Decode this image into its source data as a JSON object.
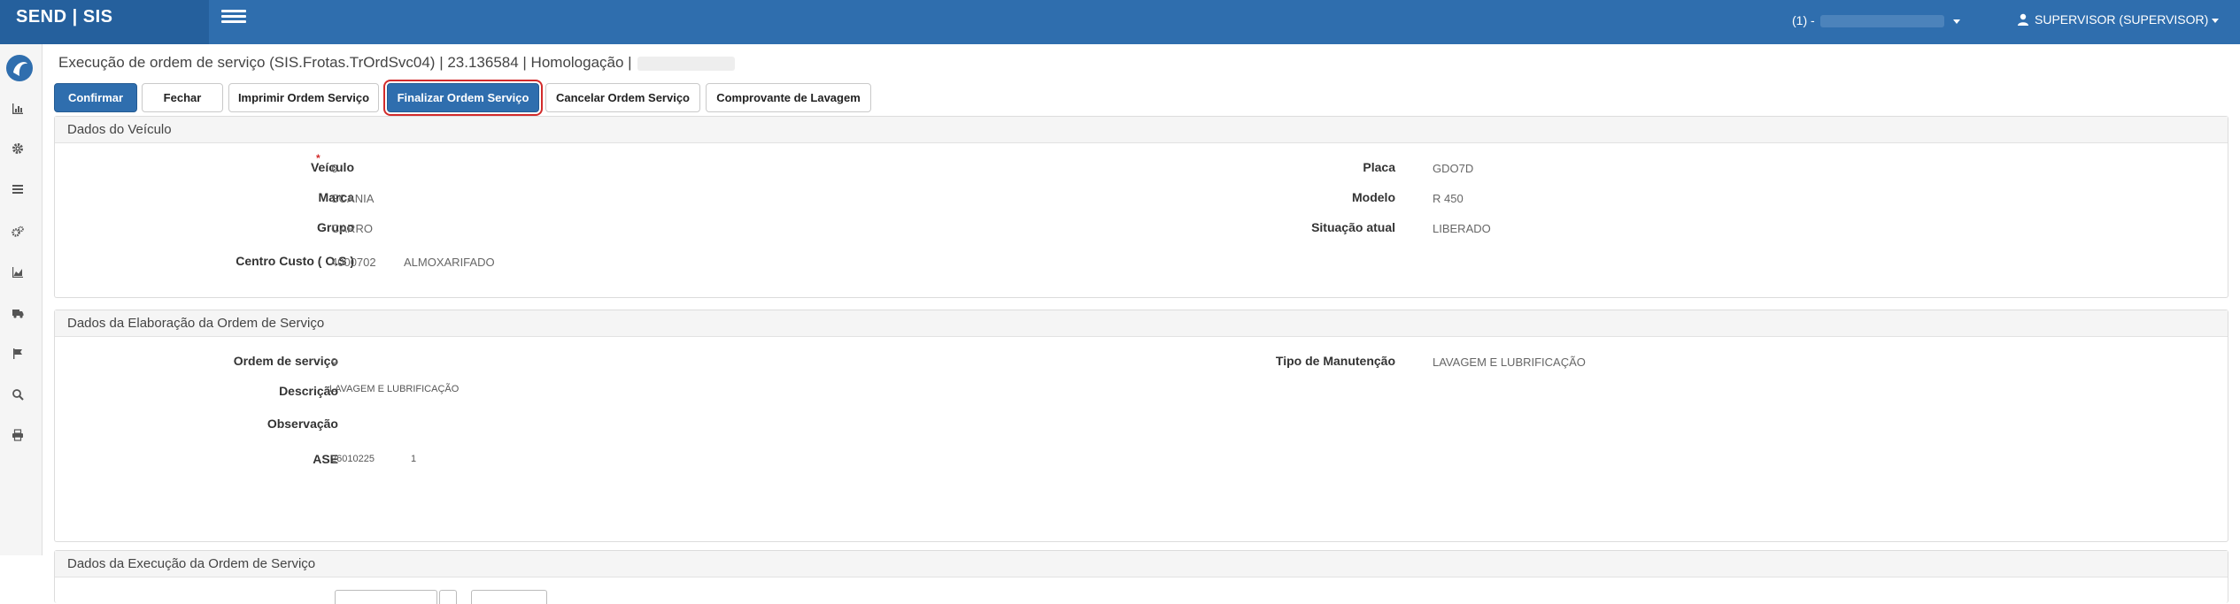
{
  "topbar": {
    "brand": "SEND | SIS",
    "store_prefix": "(1) -",
    "user": "SUPERVISOR (SUPERVISOR)"
  },
  "sidebar": {
    "items": [
      {
        "icon": "bar-chart-icon"
      },
      {
        "icon": "gear-icon"
      },
      {
        "icon": "list-icon"
      },
      {
        "icon": "gears-icon"
      },
      {
        "icon": "area-chart-icon"
      },
      {
        "icon": "truck-icon"
      },
      {
        "icon": "flag-icon"
      },
      {
        "icon": "search-icon"
      },
      {
        "icon": "print-icon"
      }
    ]
  },
  "page": {
    "title": "Execução de ordem de serviço (SIS.Frotas.TrOrdSvc04) | 23.136584 | Homologação |"
  },
  "toolbar": {
    "confirm": "Confirmar",
    "close": "Fechar",
    "print_os": "Imprimir Ordem Serviço",
    "finish_os": "Finalizar Ordem Serviço",
    "cancel_os": "Cancelar Ordem Serviço",
    "wash_receipt": "Comprovante de Lavagem"
  },
  "vehicle": {
    "heading": "Dados do Veículo",
    "veiculo_label": "Veículo",
    "veiculo_value": "6",
    "marca_label": "Marca",
    "marca_value": "SCANIA",
    "grupo_label": "Grupo",
    "grupo_value": "CARRO",
    "cc_label": "Centro Custo ( O.S )",
    "cc_code": "4000702",
    "cc_name": "ALMOXARIFADO",
    "placa_label": "Placa",
    "placa_value": "GDO7D",
    "modelo_label": "Modelo",
    "modelo_value": "R 450",
    "situacao_label": "Situação atual",
    "situacao_value": "LIBERADO"
  },
  "elaboration": {
    "heading": "Dados da Elaboração da Ordem de Serviço",
    "os_label": "Ordem de serviço",
    "os_value": "9",
    "desc_label": "Descrição",
    "desc_value": "LAVAGEM E LUBRIFICAÇÃO",
    "obs_label": "Observação",
    "ase_label": "ASE",
    "ase_code": "26010225",
    "ase_seq": "1",
    "tipo_label": "Tipo de Manutenção",
    "tipo_value": "LAVAGEM E LUBRIFICAÇÃO"
  },
  "execution": {
    "heading": "Dados da Execução da Ordem de Serviço"
  }
}
